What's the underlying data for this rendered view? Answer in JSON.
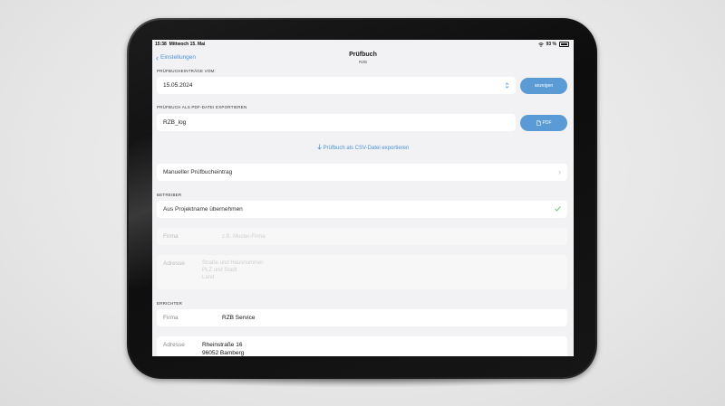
{
  "status": {
    "time": "15:38",
    "date": "Mittwoch 15. Mai",
    "battery": "93 %"
  },
  "nav": {
    "back_label": "Einstellungen",
    "title": "Prüfbuch",
    "subtitle": "RZB"
  },
  "entries": {
    "section_label": "PRÜFBUCHEINTRÄGE VOM:",
    "date_value": "15.05.2024",
    "show_button": "anzeigen"
  },
  "pdf_export": {
    "section_label": "PRÜFBUCH ALS PDF-DATEI EXPORTIEREN",
    "filename": "RZB_log",
    "button": "PDF"
  },
  "csv_export_link": "Prüfbuch als CSV-Datei exportieren",
  "manual_entry": "Manueller Prüfbucheintrag",
  "operator": {
    "section_label": "BETREIBER",
    "from_project": "Aus Projektname übernehmen",
    "firma_label": "Firma",
    "firma_placeholder": "z.B. Muster-Firma",
    "adresse_label": "Adresse",
    "adresse_placeholder_1": "Straße und Hausnummer",
    "adresse_placeholder_2": "PLZ und Stadt",
    "adresse_placeholder_3": "Land"
  },
  "builder": {
    "section_label": "ERRICHTER",
    "firma_label": "Firma",
    "firma_value": "RZB Service",
    "adresse_label": "Adresse",
    "adresse_line_1": "Rheinstraße 16",
    "adresse_line_2": "96052 Bamberg"
  },
  "colors": {
    "accent": "#5b9bd5",
    "link": "#4a90d9",
    "check": "#34c759"
  }
}
